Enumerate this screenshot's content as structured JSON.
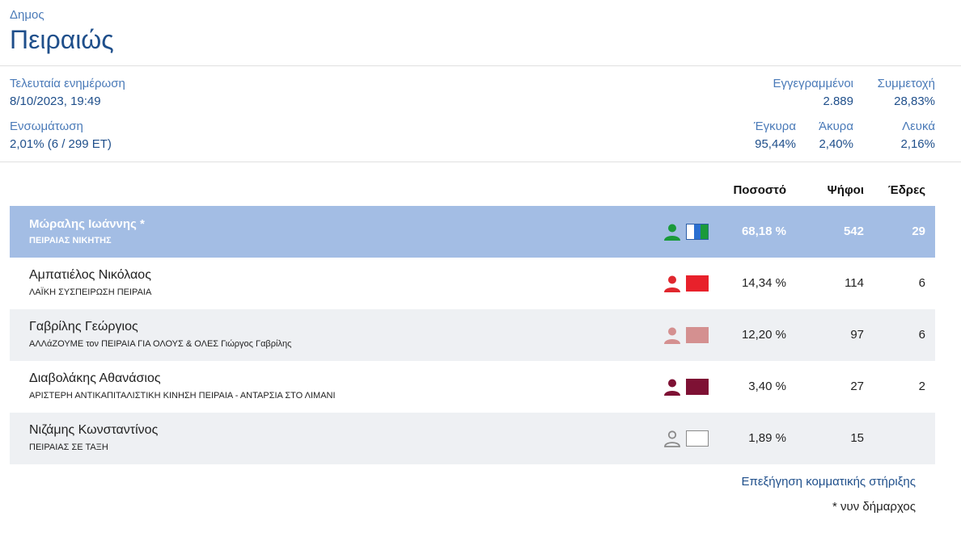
{
  "header": {
    "kicker": "Δημος",
    "title": "Πειραιώς"
  },
  "stats": {
    "updated_label": "Τελευταία ενημέρωση",
    "updated_value": "8/10/2023, 19:49",
    "integration_label": "Ενσωμάτωση",
    "integration_value": "2,01% (6 / 299 ΕΤ)",
    "registered_label": "Εγγεγραμμένοι",
    "registered_value": "2.889",
    "turnout_label": "Συμμετοχή",
    "turnout_value": "28,83%",
    "valid_label": "Έγκυρα",
    "valid_value": "95,44%",
    "invalid_label": "Άκυρα",
    "invalid_value": "2,40%",
    "blank_label": "Λευκά",
    "blank_value": "2,16%"
  },
  "table": {
    "col_pct": "Ποσοστό",
    "col_votes": "Ψήφοι",
    "col_seats": "Έδρες",
    "rows": [
      {
        "name": "Μώραλης Ιωάννης *",
        "party": "ΠΕΙΡΑΙΑΣ ΝΙΚΗΤΗΣ",
        "pct": "68,18 %",
        "votes": "542",
        "seats": "29",
        "person_color": "#1a9a3a",
        "swatch": "split"
      },
      {
        "name": "Αμπατιέλος Νικόλαος",
        "party": "ΛΑΪΚΗ ΣΥΣΠΕΙΡΩΣΗ ΠΕΙΡΑΙΑ",
        "pct": "14,34 %",
        "votes": "114",
        "seats": "6",
        "person_color": "#e0272e",
        "swatch": "#e8212b"
      },
      {
        "name": "Γαβρίλης Γεώργιος",
        "party": "ΑΛΛάΖΟΥΜΕ τον ΠΕΙΡΑΙΑ ΓΙΑ ΟΛΟΥΣ & ΟΛΕΣ Γιώργος Γαβρίλης",
        "pct": "12,20 %",
        "votes": "97",
        "seats": "6",
        "person_color": "#d49090",
        "swatch": "#d49090"
      },
      {
        "name": "Διαβολάκης Αθανάσιος",
        "party": "ΑΡΙΣΤΕΡΗ ΑΝΤΙΚΑΠΙΤΑΛΙΣΤΙΚΗ ΚΙΝΗΣΗ ΠΕΙΡΑΙΑ - ΑΝΤΑΡΣΙΑ ΣΤΟ ΛΙΜΑΝΙ",
        "pct": "3,40 %",
        "votes": "27",
        "seats": "2",
        "person_color": "#7e1134",
        "swatch": "#7e1134"
      },
      {
        "name": "Νιζάμης Κωνσταντίνος",
        "party": "ΠΕΙΡΑΙΑΣ ΣΕ ΤΑΞΗ",
        "pct": "1,89 %",
        "votes": "15",
        "seats": "",
        "person_color": "outline",
        "swatch": "empty"
      }
    ]
  },
  "footer": {
    "link": "Επεξήγηση κομματικής στήριξης",
    "note": "* νυν δήμαρχος"
  }
}
